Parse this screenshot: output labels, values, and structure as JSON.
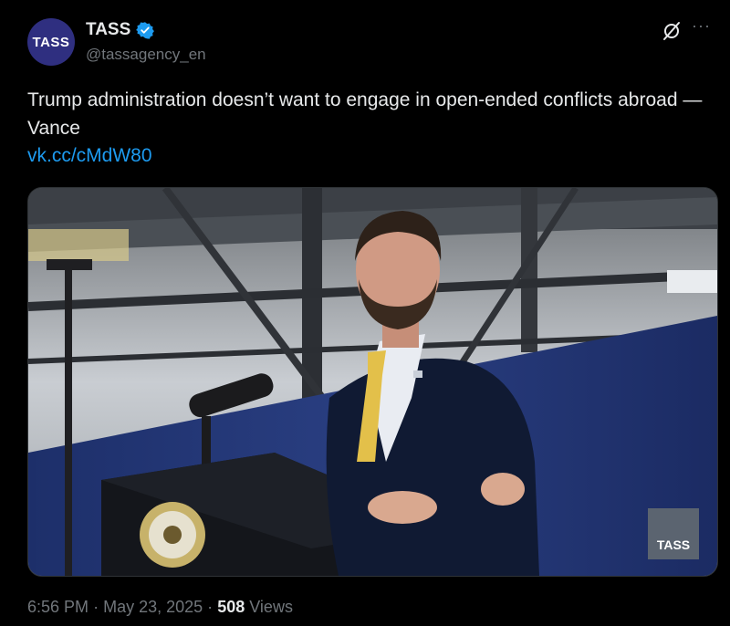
{
  "account": {
    "avatar_text": "TASS",
    "name": "TASS",
    "handle": "@tassagency_en",
    "verified": true
  },
  "icons": {
    "grok": "grok-icon",
    "more": "more-icon",
    "verified": "verified-badge-icon"
  },
  "tweet": {
    "text": "Trump administration doesn’t want to engage in open-ended conflicts abroad — Vance",
    "link": "vk.cc/cMdW80"
  },
  "media": {
    "watermark": "TASS"
  },
  "meta": {
    "time": "6:56 PM",
    "date": "May 23, 2025",
    "separator": "·",
    "views_count": "508",
    "views_label": "Views"
  },
  "colors": {
    "background": "#000000",
    "text": "#e7e9ea",
    "muted": "#71767b",
    "link": "#1d9bf0",
    "avatar": "#2f2f80"
  }
}
